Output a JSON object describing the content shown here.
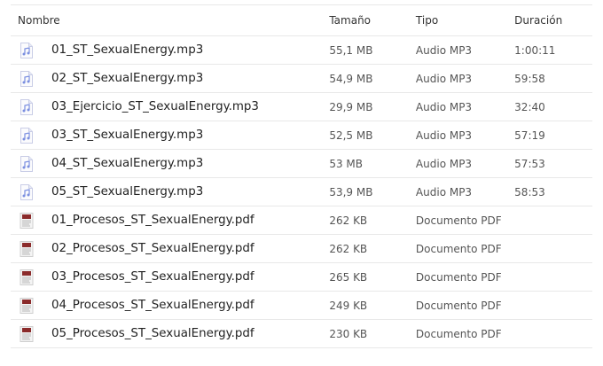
{
  "header": {
    "name": "Nombre",
    "size": "Tamaño",
    "type": "Tipo",
    "duration": "Duración"
  },
  "colors": {
    "audio_icon": "#7b8fe0",
    "pdf_icon": "#8b2b2b"
  },
  "files": [
    {
      "icon": "audio-file-icon",
      "name": "01_ST_SexualEnergy.mp3",
      "size": "55,1 MB",
      "type": "Audio MP3",
      "duration": "1:00:11"
    },
    {
      "icon": "audio-file-icon",
      "name": "02_ST_SexualEnergy.mp3",
      "size": "54,9 MB",
      "type": "Audio MP3",
      "duration": "59:58"
    },
    {
      "icon": "audio-file-icon",
      "name": "03_Ejercicio_ST_SexualEnergy.mp3",
      "size": "29,9 MB",
      "type": "Audio MP3",
      "duration": "32:40"
    },
    {
      "icon": "audio-file-icon",
      "name": "03_ST_SexualEnergy.mp3",
      "size": "52,5 MB",
      "type": "Audio MP3",
      "duration": "57:19"
    },
    {
      "icon": "audio-file-icon",
      "name": "04_ST_SexualEnergy.mp3",
      "size": "53 MB",
      "type": "Audio MP3",
      "duration": "57:53"
    },
    {
      "icon": "audio-file-icon",
      "name": "05_ST_SexualEnergy.mp3",
      "size": "53,9 MB",
      "type": "Audio MP3",
      "duration": "58:53"
    },
    {
      "icon": "pdf-file-icon",
      "name": "01_Procesos_ST_SexualEnergy.pdf",
      "size": "262 KB",
      "type": "Documento PDF",
      "duration": ""
    },
    {
      "icon": "pdf-file-icon",
      "name": "02_Procesos_ST_SexualEnergy.pdf",
      "size": "262 KB",
      "type": "Documento PDF",
      "duration": ""
    },
    {
      "icon": "pdf-file-icon",
      "name": "03_Procesos_ST_SexualEnergy.pdf",
      "size": "265 KB",
      "type": "Documento PDF",
      "duration": ""
    },
    {
      "icon": "pdf-file-icon",
      "name": "04_Procesos_ST_SexualEnergy.pdf",
      "size": "249 KB",
      "type": "Documento PDF",
      "duration": ""
    },
    {
      "icon": "pdf-file-icon",
      "name": "05_Procesos_ST_SexualEnergy.pdf",
      "size": "230 KB",
      "type": "Documento PDF",
      "duration": ""
    }
  ]
}
